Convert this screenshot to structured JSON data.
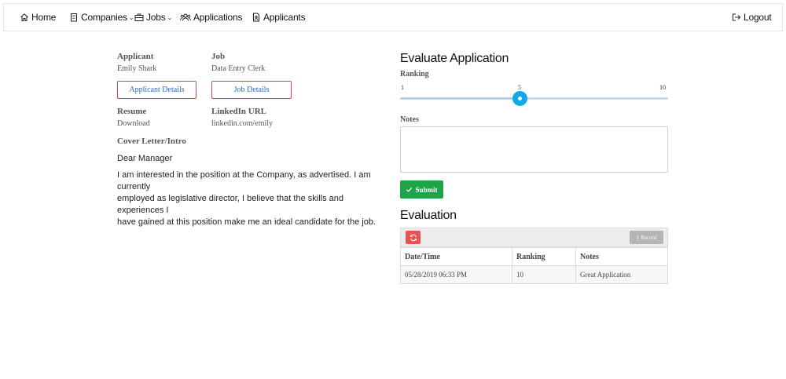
{
  "nav": {
    "home": "Home",
    "companies": "Companies",
    "jobs": "Jobs",
    "applications": "Applications",
    "applicants": "Applicants",
    "logout": "Logout"
  },
  "applicant": {
    "label": "Applicant",
    "name": "Emily Shark",
    "details_button": "Applicant Details"
  },
  "job": {
    "label": "Job",
    "title": "Data Entry Clerk",
    "details_button": "Job Details"
  },
  "resume": {
    "label": "Resume",
    "value": "Download"
  },
  "linkedin": {
    "label": "LinkedIn URL",
    "value": "linkedin.com/emily"
  },
  "cover_letter": {
    "label": "Cover Letter/Intro",
    "greeting": "Dear Manager",
    "body_lines": [
      "I am interested in the position at the Company, as advertised. I am currently",
      "employed as legislative director, I believe that the skills and experiences I",
      "have gained at this position make me an ideal candidate for the job."
    ]
  },
  "evaluate": {
    "title": "Evaluate Application",
    "ranking_label": "Ranking",
    "ranking_min": "1",
    "ranking_value": "5",
    "ranking_max": "10",
    "notes_label": "Notes",
    "notes_value": "",
    "submit_label": "Submit"
  },
  "evaluation": {
    "title": "Evaluation",
    "record_count": "1 Record",
    "columns": [
      "Date/Time",
      "Ranking",
      "Notes"
    ],
    "rows": [
      [
        "05/28/2019 06:33 PM",
        "10",
        "Great Application"
      ]
    ]
  },
  "colors": {
    "accent_blue": "#11a9e8",
    "submit_green": "#1ea447",
    "outline_red": "#e0424b",
    "refresh_red": "#e55353"
  },
  "icons": [
    "home-icon",
    "building-icon",
    "briefcase-icon",
    "users-icon",
    "file-user-icon",
    "logout-icon",
    "check-icon",
    "refresh-icon"
  ]
}
